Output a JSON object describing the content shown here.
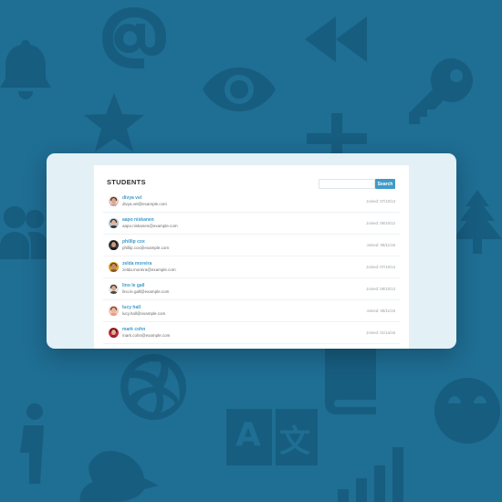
{
  "panel": {
    "title": "STUDENTS",
    "search": {
      "placeholder": "",
      "value": "",
      "button_label": "Search"
    }
  },
  "students": [
    {
      "name": "divya vel",
      "email": "divya.vel@example.com",
      "joined": "Joined: 07/10/13"
    },
    {
      "name": "aapo niskanen",
      "email": "aapo.niskanen@example.com",
      "joined": "Joined: 06/10/12"
    },
    {
      "name": "phillip cox",
      "email": "phillip.cox@example.com",
      "joined": "Joined: 08/11/16"
    },
    {
      "name": "zelda moreira",
      "email": "zelda.moreira@example.com",
      "joined": "Joined: 07/10/13"
    },
    {
      "name": "lino le gall",
      "email": "lino.le.gall@example.com",
      "joined": "Joined: 08/10/13"
    },
    {
      "name": "lucy hall",
      "email": "lucy.hall@example.com",
      "joined": "Joined: 08/11/16"
    },
    {
      "name": "mark cohn",
      "email": "mark.cohn@example.com",
      "joined": "Joined: 01/1a/16"
    }
  ],
  "background_icons": [
    "at-sign-icon",
    "rewind-icon",
    "bell-icon",
    "eye-icon",
    "key-icon",
    "star-icon",
    "plus-icon",
    "users-icon",
    "tree-icon",
    "volleyball-icon",
    "book-icon",
    "translate-icon",
    "person-icon",
    "crying-face-icon",
    "signal-bars-icon",
    "bird-icon"
  ],
  "colors": {
    "background": "#1f6e94",
    "background_icon": "#175d80",
    "card": "#e3f0f6",
    "accent": "#3f9bc9"
  }
}
